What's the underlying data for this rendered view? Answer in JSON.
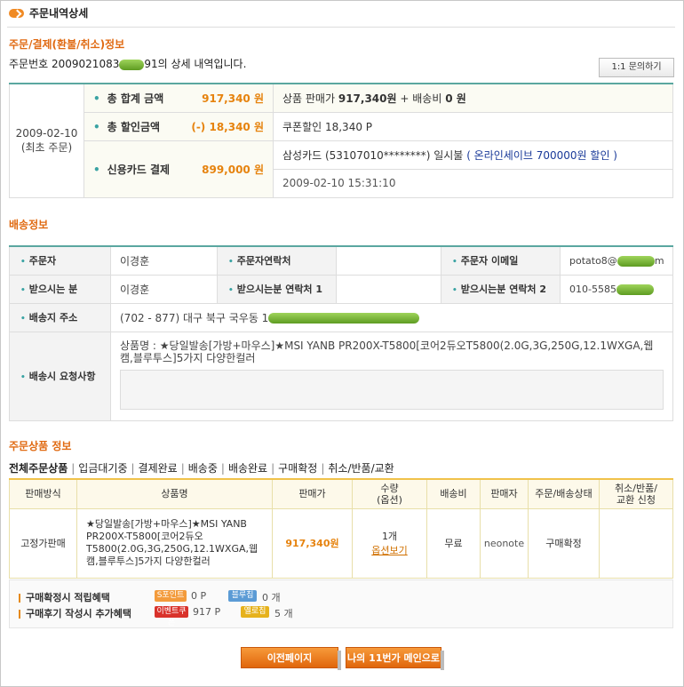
{
  "header": {
    "title": "주문내역상세"
  },
  "order_section": {
    "title": "주문/결제(환불/취소)정보",
    "order_prefix": "주문번호",
    "order_number_visible": "2009021083",
    "order_number_tail": "91",
    "order_suffix": "의 상세 내역입니다.",
    "inquiry_button": "1:1 문의하기"
  },
  "payment": {
    "date": "2009-02-10",
    "date_note": "(최초 주문)",
    "rows": [
      {
        "label": "총 합계 금액",
        "amount": "917,340 원",
        "info_a": "상품 판매가",
        "info_b": "917,340원",
        "info_c": "+ 배송비",
        "info_d": "0 원"
      },
      {
        "label": "총 할인금액",
        "amount": "(-) 18,340 원",
        "info": "쿠폰할인 18,340 P"
      },
      {
        "label": "신용카드 결제",
        "amount": "899,000 원",
        "card": "삼성카드 (53107010********) 일시불",
        "promo": "( 온라인세이브 700000원 할인 )",
        "timestamp": "2009-02-10 15:31:10"
      }
    ]
  },
  "shipping": {
    "title": "배송정보",
    "orderer_label": "주문자",
    "orderer": "이경훈",
    "orderer_contact_label": "주문자연락처",
    "orderer_contact": "",
    "orderer_email_label": "주문자 이메일",
    "orderer_email_prefix": "potato8@",
    "orderer_email_suffix": "m",
    "recipient_label": "받으시는 분",
    "recipient": "이경훈",
    "recipient_contact1_label": "받으시는분 연락처 1",
    "recipient_contact1": "",
    "recipient_contact2_label": "받으시는분 연락처 2",
    "recipient_contact2": "010-5585",
    "address_label": "배송지 주소",
    "address": "(702 - 877) 대구 북구 국우동 1",
    "request_label": "배송시 요청사항",
    "request_text": "상품명 : ★당일발송[가방+마우스]★MSI YANB PR200X-T5800[코어2듀오T5800(2.0G,3G,250G,12.1WXGA,웹캠,블루투스]5가지 다양한컬러"
  },
  "products": {
    "title": "주문상품 정보",
    "tabs": [
      "전체주문상품",
      "입금대기중",
      "결제완료",
      "배송중",
      "배송완료",
      "구매확정",
      "취소/반품/교환"
    ],
    "headers": [
      "판매방식",
      "상품명",
      "판매가",
      "수량\n(옵션)",
      "배송비",
      "판매자",
      "주문/배송상태",
      "취소/반품/\n교환 신청"
    ],
    "row": {
      "method": "고정가판매",
      "name": "★당일발송[가방+마우스]★MSI YANB PR200X-T5800[코어2듀오T5800(2.0G,3G,250G,12.1WXGA,웹캠,블루투스]5가지 다양한컬러",
      "price": "917,340원",
      "qty": "1개",
      "option_link": "옵션보기",
      "shipping": "무료",
      "seller": "neonote",
      "status": "구매확정",
      "cancel": ""
    }
  },
  "benefits": {
    "row1_label": "구매확정시 적립혜택",
    "row1_badge1": "S포인트",
    "row1_val1": "0 P",
    "row1_badge2": "블루칩",
    "row1_val2": "0 개",
    "row2_label": "구매후기 작성시 추가혜택",
    "row2_badge1": "이벤트쿠폰",
    "row2_val1": "917 P",
    "row2_badge2": "옐로칩",
    "row2_val2": "5 개"
  },
  "footer": {
    "prev_button": "이전페이지",
    "main_button": "나의 11번가 메인으로"
  },
  "colors": {
    "accent": "#e6830e",
    "teal": "#5aa7a0",
    "link_blue": "#1a3a99"
  }
}
